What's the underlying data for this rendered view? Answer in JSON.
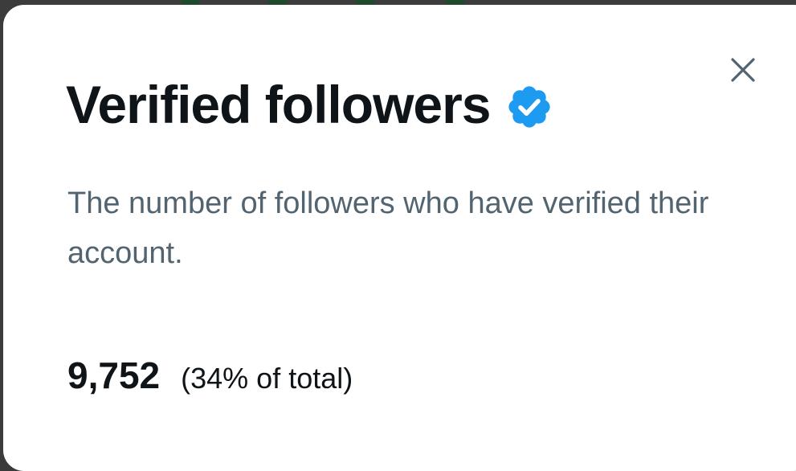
{
  "modal": {
    "title": "Verified followers",
    "description": "The number of followers who have verified their account.",
    "stat": {
      "value": "9,752",
      "percent_label": "(34% of total)"
    }
  },
  "icons": {
    "close": "close-icon",
    "badge": "verified-badge-icon"
  },
  "colors": {
    "badge_blue": "#1d9bf0",
    "title_text": "#0f1419",
    "secondary_text": "#536471",
    "close_icon": "#536471"
  }
}
